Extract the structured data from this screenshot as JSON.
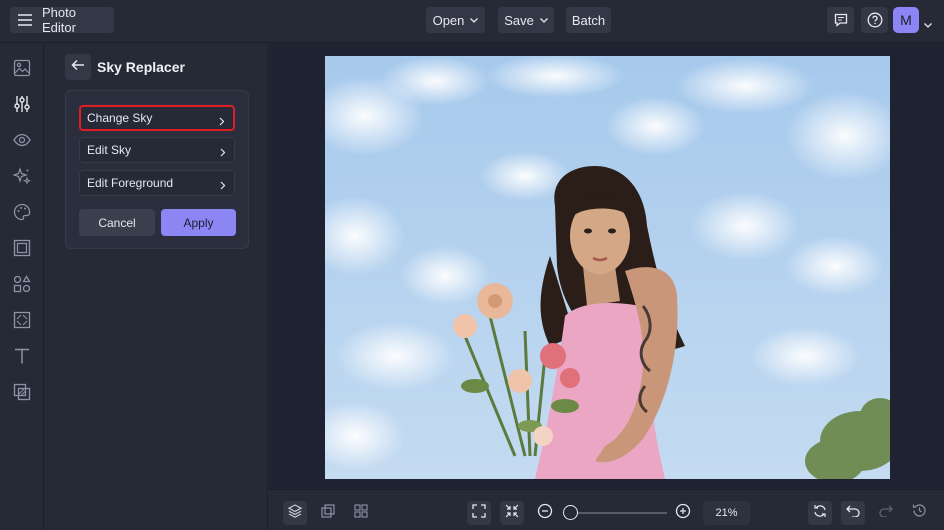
{
  "app": {
    "title": "Photo Editor"
  },
  "toolbar": {
    "open_label": "Open",
    "save_label": "Save",
    "batch_label": "Batch",
    "avatar_initial": "M"
  },
  "rail": {
    "items": [
      "image-icon",
      "adjustments-icon",
      "eye-icon",
      "sparkle-effects-icon",
      "palette-icon",
      "frame-icon",
      "shapes-icon",
      "texture-icon",
      "text-icon",
      "overlay-icon"
    ]
  },
  "panel": {
    "title": "Sky Replacer",
    "options": [
      {
        "label": "Change Sky"
      },
      {
        "label": "Edit Sky"
      },
      {
        "label": "Edit Foreground"
      }
    ],
    "cancel_label": "Cancel",
    "apply_label": "Apply"
  },
  "zoom": {
    "value_text": "21%",
    "level_percent": 21
  },
  "colors": {
    "accent": "#8c86f5",
    "highlight": "#e01c24",
    "background": "#262a37",
    "canvas_background": "#1f2230"
  }
}
